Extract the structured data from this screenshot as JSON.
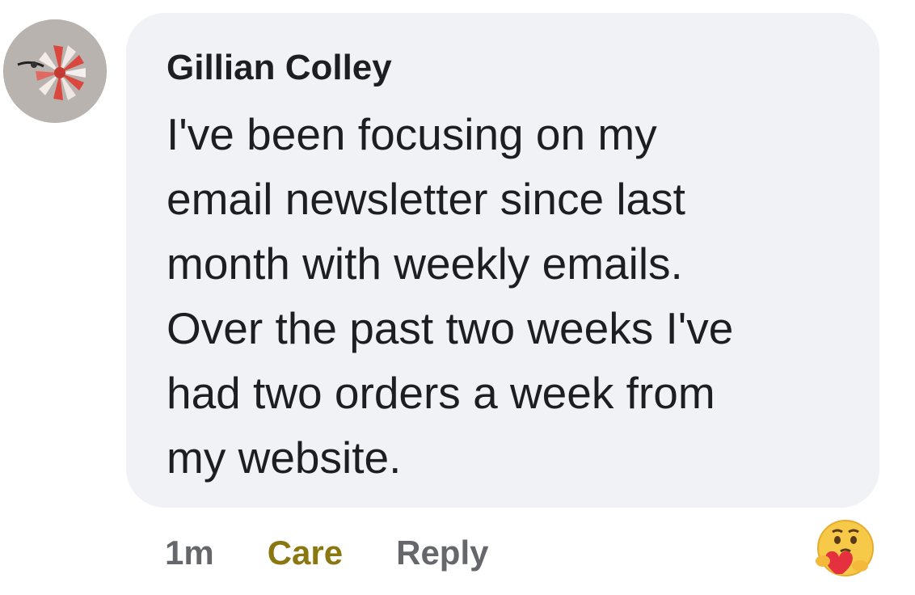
{
  "comment": {
    "author": "Gillian Colley",
    "text": "I've been focusing on my\nemail newsletter since last\nmonth with weekly emails.\nOver the past two weeks I've\nhad two orders a week from\nmy website.",
    "time": "1m",
    "reaction_label": "Care",
    "reply_label": "Reply",
    "reaction_icon": "care-emoji-icon"
  },
  "colors": {
    "bubble_bg": "#f0f2f5",
    "text": "#1c1e21",
    "meta": "#65676b",
    "care": "#8a7710"
  }
}
